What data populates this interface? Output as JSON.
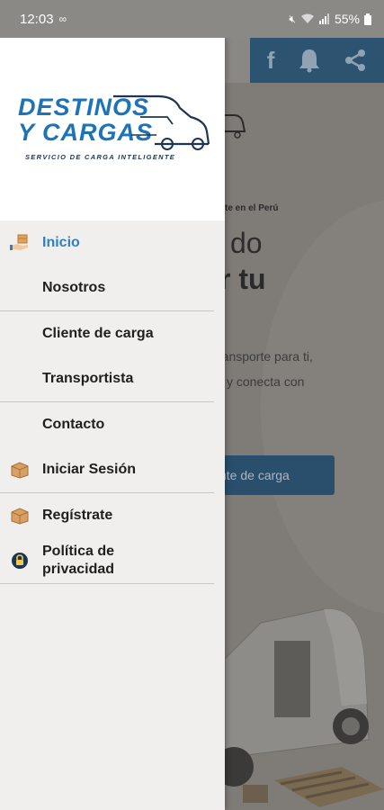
{
  "status_bar": {
    "time": "12:03",
    "voicemail_icon": "voicemail-icon",
    "battery": "55%"
  },
  "drawer": {
    "logo": {
      "line1": "DESTINOS",
      "line2": "Y CARGAS",
      "tagline": "SERVICIO DE CARGA INTELIGENTE"
    },
    "menu": [
      {
        "label": "Inicio",
        "icon": "hand-box-icon",
        "active": true
      },
      {
        "label": "Nosotros"
      },
      {
        "label": "Cliente de carga"
      },
      {
        "label": "Transportista"
      },
      {
        "label": "Contacto"
      },
      {
        "label": "Iniciar Sesión",
        "icon": "package-icon"
      },
      {
        "label": "Regístrate",
        "icon": "package-icon"
      },
      {
        "label": "Política de privacidad",
        "label_line1": "Política de",
        "label_line2": "privacidad",
        "icon": "lock-icon"
      }
    ]
  },
  "background": {
    "topbar_icons": [
      "facebook-icon",
      "bell-icon",
      "share-icon"
    ],
    "small_text": "te en el Perú",
    "headline_line1": "do",
    "headline_line2": "r tu",
    "para_line1": "ransporte para ti,",
    "para_line2": "y conecta con",
    "button_label": "nte de carga"
  },
  "colors": {
    "accent": "#2f80c3",
    "logo_blue": "#1e73b8",
    "drawer_bg": "#f0efed"
  }
}
